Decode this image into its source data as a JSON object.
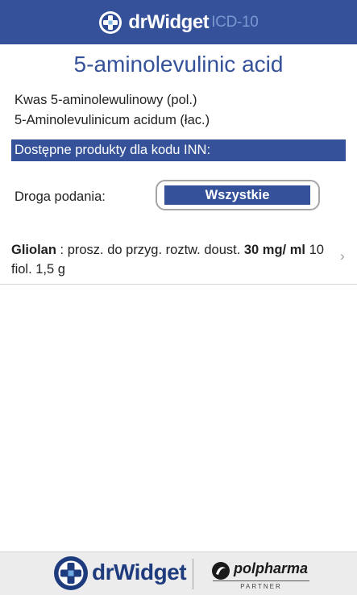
{
  "header": {
    "brand": "drWidget",
    "sub": "ICD-10"
  },
  "drug": {
    "title": "5-aminolevulinic acid",
    "synonym_pl": "Kwas 5-aminolewulinowy  (pol.)",
    "synonym_lat": "5-Aminolevulinicum acidum  (łac.)"
  },
  "section": {
    "products_header": "Dostępne produkty dla kodu INN:"
  },
  "filter": {
    "route_label": "Droga podania:",
    "route_value": "Wszystkie"
  },
  "products": [
    {
      "name": "Gliolan",
      "separator": " :  ",
      "form": "prosz. do przyg. roztw. doust. ",
      "strength": "30 mg/ ml",
      "pack": " 10 fiol. 1,5 g"
    }
  ],
  "footer": {
    "brand": "drWidget",
    "partner_name": "polpharma",
    "partner_label": "PARTNER"
  },
  "icons": {
    "logo": "drwidget-logo-icon",
    "chevron": "chevron-right-icon",
    "partner_logo": "polpharma-logo-icon"
  },
  "colors": {
    "brand_blue": "#34519a",
    "footer_bg": "#ececec"
  }
}
